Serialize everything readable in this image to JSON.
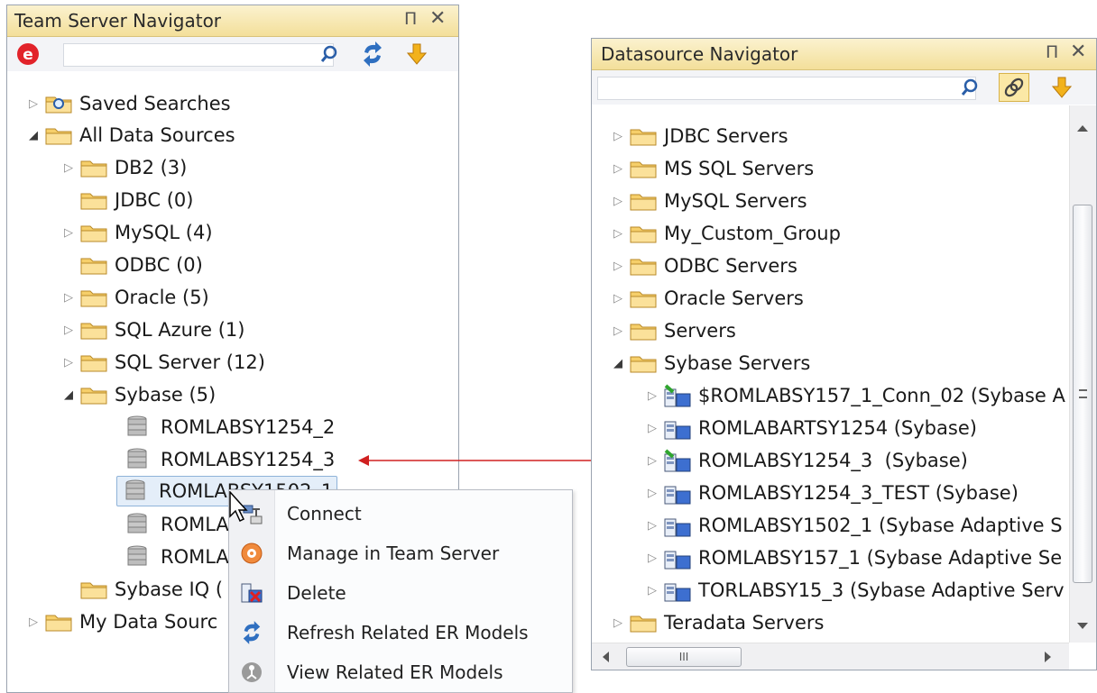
{
  "team_navigator": {
    "title": "Team Server Navigator",
    "pin": "Π",
    "close": "✕",
    "tree": [
      {
        "label": "Saved Searches",
        "expander": "▷"
      },
      {
        "label": "All Data Sources",
        "expander": "◢"
      },
      {
        "label": "DB2 (3)",
        "expander": "▷"
      },
      {
        "label": "JDBC (0)",
        "expander": ""
      },
      {
        "label": "MySQL (4)",
        "expander": "▷"
      },
      {
        "label": "ODBC (0)",
        "expander": ""
      },
      {
        "label": "Oracle (5)",
        "expander": "▷"
      },
      {
        "label": "SQL Azure (1)",
        "expander": "▷"
      },
      {
        "label": "SQL Server (12)",
        "expander": "▷"
      },
      {
        "label": "Sybase (5)",
        "expander": "◢"
      },
      {
        "label": "ROMLABSY1254_2"
      },
      {
        "label": "ROMLABSY1254_3"
      },
      {
        "label": "ROMLABSY1502_1"
      },
      {
        "label": "ROMLA"
      },
      {
        "label": "ROMLA"
      },
      {
        "label": "Sybase IQ (",
        "expander": ""
      },
      {
        "label": "My Data Sourc",
        "expander": "▷"
      }
    ]
  },
  "context_menu": {
    "items": [
      {
        "label": "Connect",
        "icon": "connect-icon"
      },
      {
        "label": "Manage in Team Server",
        "icon": "team-server-icon"
      },
      {
        "label": "Delete",
        "icon": "delete-icon"
      },
      {
        "label": "Refresh Related ER Models",
        "icon": "refresh-icon"
      },
      {
        "label": "View Related ER Models",
        "icon": "er-models-icon"
      }
    ]
  },
  "datasource_navigator": {
    "title": "Datasource Navigator",
    "pin": "Π",
    "close": "✕",
    "tree": [
      {
        "label": "JDBC Servers",
        "expander": "▷"
      },
      {
        "label": "MS SQL Servers",
        "expander": "▷"
      },
      {
        "label": "MySQL Servers",
        "expander": "▷"
      },
      {
        "label": "My_Custom_Group",
        "expander": "▷"
      },
      {
        "label": "ODBC Servers",
        "expander": "▷"
      },
      {
        "label": "Oracle Servers",
        "expander": "▷"
      },
      {
        "label": "Servers",
        "expander": "▷"
      },
      {
        "label": "Sybase Servers",
        "expander": "◢"
      },
      {
        "label": "$ROMLABSY157_1_Conn_02 (Sybase A",
        "expander": "▷"
      },
      {
        "label": "ROMLABARTSY1254 (Sybase)",
        "expander": "▷"
      },
      {
        "label": "ROMLABSY1254_3  (Sybase)",
        "expander": "▷"
      },
      {
        "label": "ROMLABSY1254_3_TEST (Sybase)",
        "expander": "▷"
      },
      {
        "label": "ROMLABSY1502_1 (Sybase Adaptive S",
        "expander": "▷"
      },
      {
        "label": "ROMLABSY157_1 (Sybase Adaptive Se",
        "expander": "▷"
      },
      {
        "label": "TORLABSY15_3 (Sybase Adaptive Serv",
        "expander": "▷"
      },
      {
        "label": "Teradata Servers",
        "expander": "▷"
      }
    ],
    "hscroll_grip": "III"
  },
  "colors": {
    "arrow": "#d02020",
    "title_bar": "#f3df9a",
    "folder": "#f4c55a"
  }
}
